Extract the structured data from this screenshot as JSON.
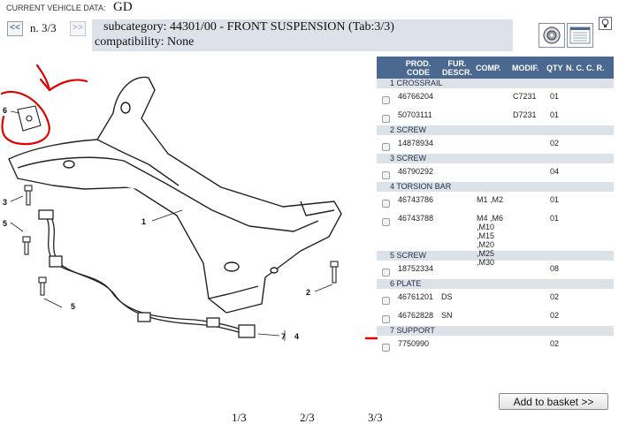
{
  "header": {
    "vehicle_label": "CURRENT VEHICLE DATA:",
    "vehicle_value": "GD",
    "prev_label": "<<",
    "next_label": ">>",
    "page_indicator": "n. 3/3",
    "subcategory": "subcategory: 44301/00 - FRONT SUSPENSION (Tab:3/3)",
    "compatibility": "compatibility: None"
  },
  "diagram": {
    "callouts": [
      "6",
      "3",
      "5",
      "5",
      "1",
      "2",
      "7",
      "4"
    ]
  },
  "table": {
    "headers": {
      "code": "PROD. CODE",
      "desc": "FUR. DESCR.",
      "comp": "COMP.",
      "modif": "MODIF.",
      "qty": "QTY",
      "ncc": "N. C. C. R."
    },
    "groups": [
      {
        "label": "1 CROSSRAIL",
        "parts": [
          {
            "code": "46766204",
            "desc": "",
            "comp": "",
            "modif": "C7231",
            "qty": "01"
          },
          {
            "code": "50703111",
            "desc": "",
            "comp": "",
            "modif": "D7231",
            "qty": "01"
          }
        ]
      },
      {
        "label": "2 SCREW",
        "parts": [
          {
            "code": "14878934",
            "desc": "",
            "comp": "",
            "modif": "",
            "qty": "02"
          }
        ]
      },
      {
        "label": "3 SCREW",
        "parts": [
          {
            "code": "46790292",
            "desc": "",
            "comp": "",
            "modif": "",
            "qty": "04"
          }
        ]
      },
      {
        "label": "4 TORSION BAR",
        "parts": [
          {
            "code": "46743786",
            "desc": "",
            "comp": "M1 ,M2",
            "modif": "",
            "qty": "01"
          },
          {
            "code": "46743788",
            "desc": "",
            "comp": "M4 ,M6\n,M10\n,M15\n,M20\n,M25\n,M30",
            "modif": "",
            "qty": "01"
          }
        ]
      },
      {
        "label": "5 SCREW",
        "parts": [
          {
            "code": "18752334",
            "desc": "",
            "comp": "",
            "modif": "",
            "qty": "08"
          }
        ]
      },
      {
        "label": "6 PLATE",
        "parts": [
          {
            "code": "46761201",
            "desc": "DS",
            "comp": "",
            "modif": "",
            "qty": "02"
          },
          {
            "code": "46762828",
            "desc": "SN",
            "comp": "",
            "modif": "",
            "qty": "02"
          }
        ]
      },
      {
        "label": "7 SUPPORT",
        "parts": [
          {
            "code": "7750990",
            "desc": "",
            "comp": "",
            "modif": "",
            "qty": "02"
          }
        ]
      }
    ]
  },
  "basket_label": "Add to basket >>",
  "pages": [
    "1/3",
    "2/3",
    "3/3"
  ],
  "colors": {
    "header_bg": "#4a6890",
    "group_bg": "#dde2e9",
    "annotation_red": "#e00000"
  }
}
